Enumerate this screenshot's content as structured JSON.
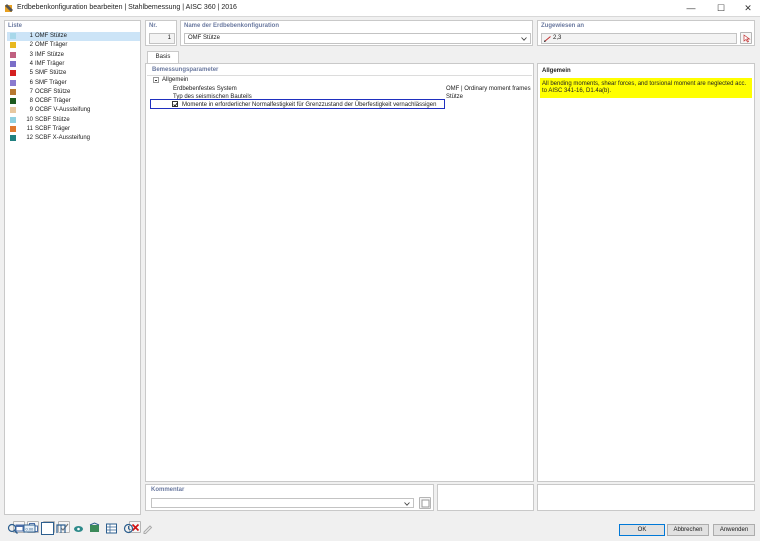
{
  "window": {
    "title": "Erdbebenkonfiguration bearbeiten | Stahlbemessung | AISC 360 | 2016",
    "minimize_glyph": "—",
    "maximize_glyph": "☐",
    "close_glyph": "✕"
  },
  "list": {
    "title": "Liste",
    "items": [
      {
        "num": "1",
        "name": "OMF Stütze",
        "color": "#a8d8ea",
        "selected": true
      },
      {
        "num": "2",
        "name": "OMF Träger",
        "color": "#e8b820",
        "selected": false
      },
      {
        "num": "3",
        "name": "IMF Stütze",
        "color": "#c06080",
        "selected": false
      },
      {
        "num": "4",
        "name": "IMF Träger",
        "color": "#7a6ec8",
        "selected": false
      },
      {
        "num": "5",
        "name": "SMF Stütze",
        "color": "#d42020",
        "selected": false
      },
      {
        "num": "6",
        "name": "SMF Träger",
        "color": "#8a7acf",
        "selected": false
      },
      {
        "num": "7",
        "name": "OCBF Stütze",
        "color": "#b87830",
        "selected": false
      },
      {
        "num": "8",
        "name": "OCBF Träger",
        "color": "#1e5a1e",
        "selected": false
      },
      {
        "num": "9",
        "name": "OCBF V-Aussteifung",
        "color": "#e8c8a0",
        "selected": false
      },
      {
        "num": "10",
        "name": "SCBF Stütze",
        "color": "#8fd0e0",
        "selected": false
      },
      {
        "num": "11",
        "name": "SCBF Träger",
        "color": "#e07830",
        "selected": false
      },
      {
        "num": "12",
        "name": "SCBF X-Aussteifung",
        "color": "#208080",
        "selected": false
      }
    ]
  },
  "header": {
    "nr_label": "Nr.",
    "nr_value": "1",
    "name_label": "Name der Erdbebenkonfiguration",
    "name_value": "OMF Stütze",
    "assigned_label": "Zugewiesen an",
    "assigned_value": "2,3"
  },
  "tabs": [
    "Basis"
  ],
  "params": {
    "title": "Bemessungsparameter",
    "group": "Allgemein",
    "rows": [
      {
        "label": "Erdbebenfestes System",
        "value": "OMF | Ordinary moment frames"
      },
      {
        "label": "Typ des seismischen Bauteils",
        "value": "Stütze"
      }
    ],
    "checkbox_label": "Momente in erforderlicher Normalfestigkeit für Grenzzustand der Überfestigkeit vernachlässigen",
    "checkbox_checked": true
  },
  "info": {
    "title": "Allgemein",
    "text": "All bending moments, shear forces, and torsional moment are neglected acc. to AISC 341-16, D1.4a(b)."
  },
  "comment": {
    "title": "Kommentar",
    "value": ""
  },
  "buttons": {
    "ok": "OK",
    "cancel": "Abbrechen",
    "apply": "Anwenden"
  },
  "colors": {
    "accent": "#0078d7",
    "highlight_border": "#1f2fbf",
    "info_bg": "#ffff00",
    "selection": "#cce4f7",
    "section_title": "#6b7aa0"
  }
}
